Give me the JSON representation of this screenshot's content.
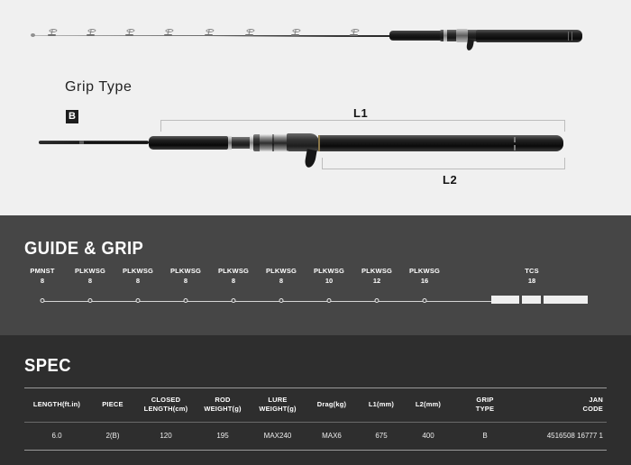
{
  "product_diagram": {
    "grip_type_title": "Grip Type",
    "grip_type_badge": "B",
    "dimension_labels": {
      "l1": "L1",
      "l2": "L2"
    }
  },
  "guide_section": {
    "title": "GUIDE & GRIP",
    "guides": [
      {
        "code": "PMNST",
        "size": "8"
      },
      {
        "code": "PLKWSG",
        "size": "8"
      },
      {
        "code": "PLKWSG",
        "size": "8"
      },
      {
        "code": "PLKWSG",
        "size": "8"
      },
      {
        "code": "PLKWSG",
        "size": "8"
      },
      {
        "code": "PLKWSG",
        "size": "8"
      },
      {
        "code": "PLKWSG",
        "size": "10"
      },
      {
        "code": "PLKWSG",
        "size": "12"
      },
      {
        "code": "PLKWSG",
        "size": "16"
      },
      {
        "code": "TCS",
        "size": "18"
      }
    ]
  },
  "spec_section": {
    "title": "SPEC",
    "columns": [
      "LENGTH(ft.in)",
      "PIECE",
      "CLOSED LENGTH(cm)",
      "ROD WEIGHT(g)",
      "LURE WEIGHT(g)",
      "Drag(kg)",
      "L1(mm)",
      "L2(mm)",
      "GRIP TYPE",
      "JAN CODE"
    ],
    "rows": [
      {
        "length": "6.0",
        "piece": "2(B)",
        "closed_length": "120",
        "rod_weight": "195",
        "lure_weight": "MAX240",
        "drag": "MAX6",
        "l1": "675",
        "l2": "400",
        "grip_type": "B",
        "jan_code": "4516508 16777 1"
      }
    ]
  },
  "colors": {
    "page_background": "#f0f0f0",
    "guide_panel_background": "#464646",
    "spec_panel_background": "#2e2e2e",
    "text_light": "#ffffff",
    "rule": "#9a9a9a"
  }
}
